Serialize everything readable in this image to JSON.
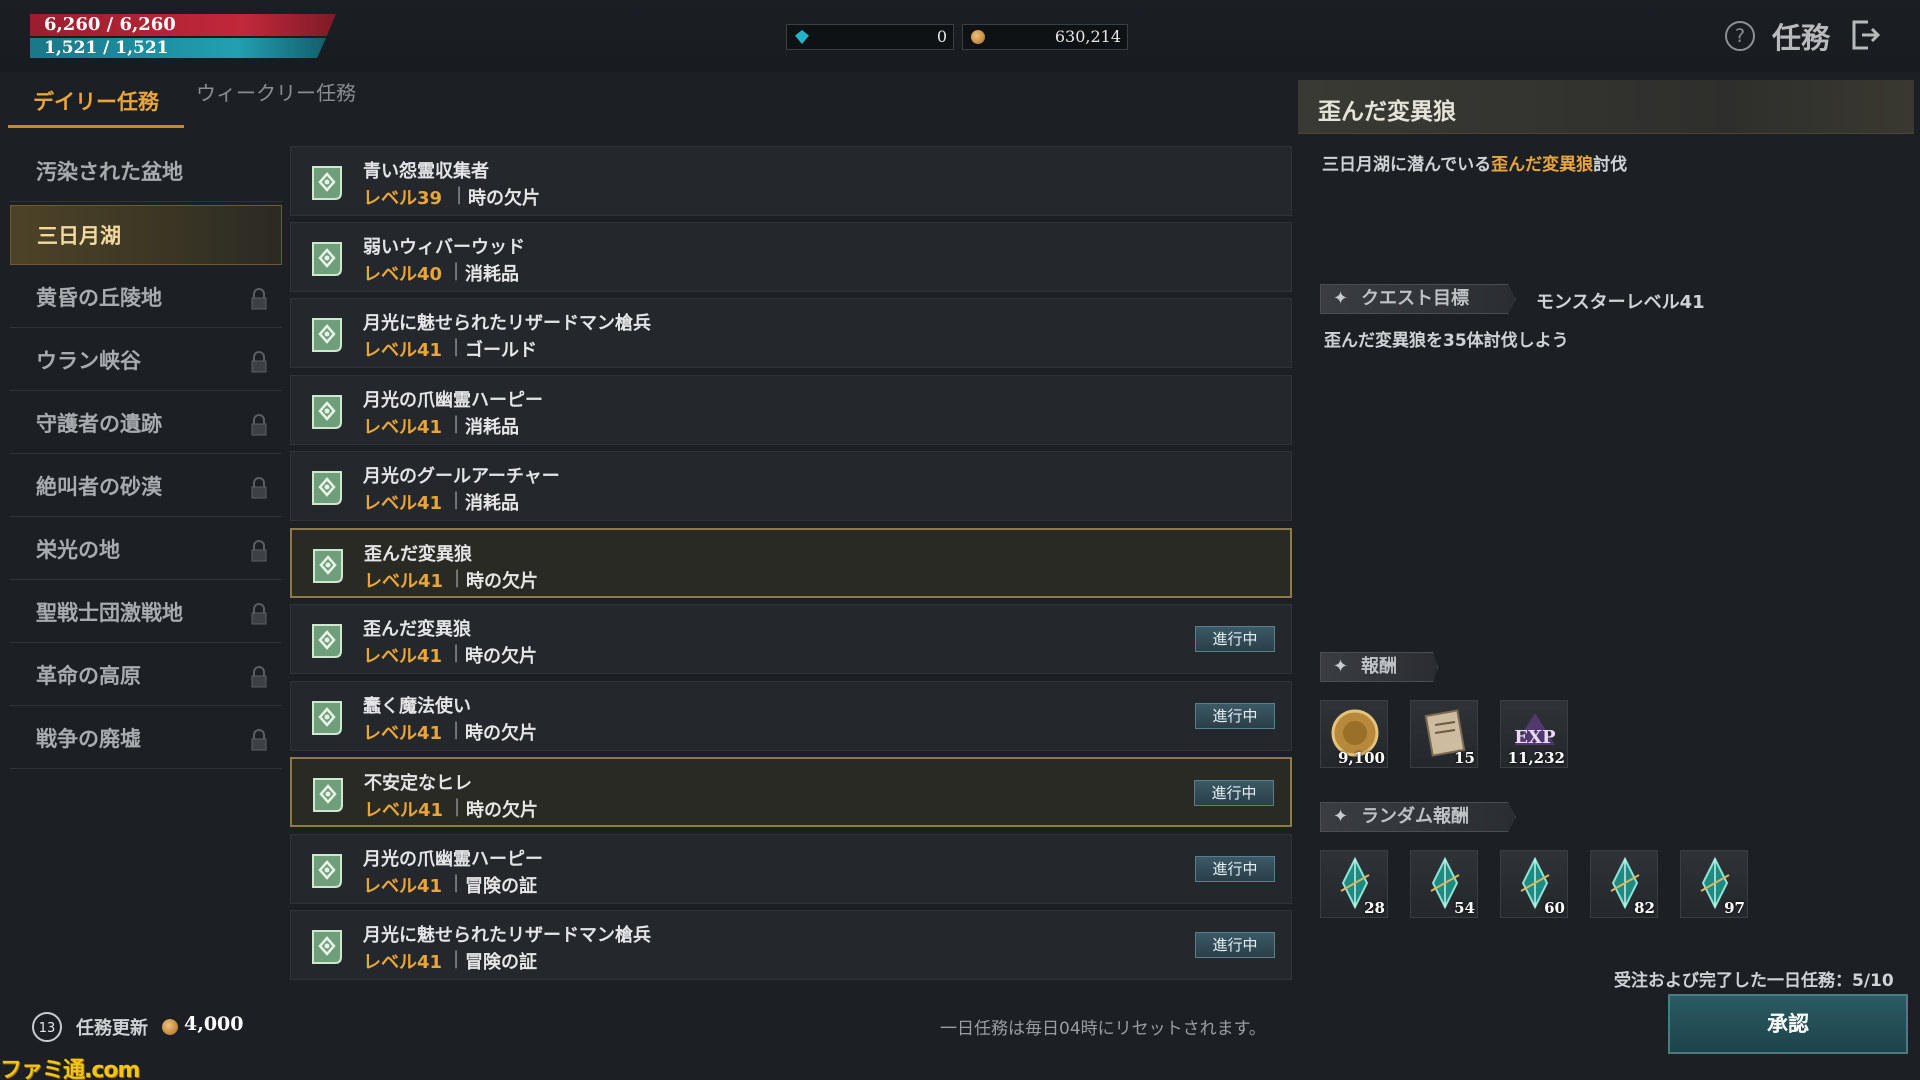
{
  "hud": {
    "hp": "6,260 / 6,260",
    "mp": "1,521 / 1,521",
    "gems": "0",
    "gold": "630,214",
    "title": "任務"
  },
  "tabs": {
    "daily": "デイリー任務",
    "weekly": "ウィークリー任務"
  },
  "regions": [
    {
      "name": "汚染された盆地",
      "locked": false
    },
    {
      "name": "三日月湖",
      "locked": false
    },
    {
      "name": "黄昏の丘陵地",
      "locked": true
    },
    {
      "name": "ウラン峡谷",
      "locked": true
    },
    {
      "name": "守護者の遺跡",
      "locked": true
    },
    {
      "name": "絶叫者の砂漠",
      "locked": true
    },
    {
      "name": "栄光の地",
      "locked": true
    },
    {
      "name": "聖戦士団激戦地",
      "locked": true
    },
    {
      "name": "革命の高原",
      "locked": true
    },
    {
      "name": "戦争の廃墟",
      "locked": true
    }
  ],
  "quests": [
    {
      "name": "青い怨霊収集者",
      "level": "レベル39",
      "reward": "時の欠片",
      "status": ""
    },
    {
      "name": "弱いウィバーウッド",
      "level": "レベル40",
      "reward": "消耗品",
      "status": ""
    },
    {
      "name": "月光に魅せられたリザードマン槍兵",
      "level": "レベル41",
      "reward": "ゴールド",
      "status": ""
    },
    {
      "name": "月光の爪幽霊ハーピー",
      "level": "レベル41",
      "reward": "消耗品",
      "status": ""
    },
    {
      "name": "月光のグールアーチャー",
      "level": "レベル41",
      "reward": "消耗品",
      "status": ""
    },
    {
      "name": "歪んだ変異狼",
      "level": "レベル41",
      "reward": "時の欠片",
      "status": ""
    },
    {
      "name": "歪んだ変異狼",
      "level": "レベル41",
      "reward": "時の欠片",
      "status": "進行中"
    },
    {
      "name": "蠢く魔法使い",
      "level": "レベル41",
      "reward": "時の欠片",
      "status": "進行中"
    },
    {
      "name": "不安定なヒレ",
      "level": "レベル41",
      "reward": "時の欠片",
      "status": "進行中"
    },
    {
      "name": "月光の爪幽霊ハーピー",
      "level": "レベル41",
      "reward": "冒険の証",
      "status": "進行中"
    },
    {
      "name": "月光に魅せられたリザードマン槍兵",
      "level": "レベル41",
      "reward": "冒険の証",
      "status": "進行中"
    }
  ],
  "detail": {
    "title": "歪んだ変異狼",
    "desc_pre": "三日月湖に潜んでいる",
    "desc_highlight": "歪んだ変異狼",
    "desc_post": "討伐",
    "objective_label": "クエスト目標",
    "monster_level": "モンスターレベル41",
    "objective": "歪んだ変異狼を35体討伐しよう",
    "rewards_label": "報酬",
    "rewards": [
      {
        "icon": "gold-coin-icon",
        "count": "9,100"
      },
      {
        "icon": "scroll-icon",
        "count": "15"
      },
      {
        "icon": "exp-icon",
        "count": "11,232",
        "label": "EXP"
      }
    ],
    "random_label": "ランダム報酬",
    "random_rewards": [
      {
        "icon": "crystal-icon",
        "count": "28"
      },
      {
        "icon": "crystal-icon",
        "count": "54"
      },
      {
        "icon": "crystal-icon",
        "count": "60"
      },
      {
        "icon": "crystal-icon",
        "count": "82"
      },
      {
        "icon": "crystal-icon",
        "count": "97"
      }
    ],
    "daily_count": "受注および完了した一日任務：5/10",
    "approve": "承認"
  },
  "footer": {
    "refresh_count": "13",
    "refresh_label": "任務更新",
    "refresh_cost": "4,000",
    "reset_note": "一日任務は毎日04時にリセットされます。",
    "watermark": "ファミ通.com"
  }
}
